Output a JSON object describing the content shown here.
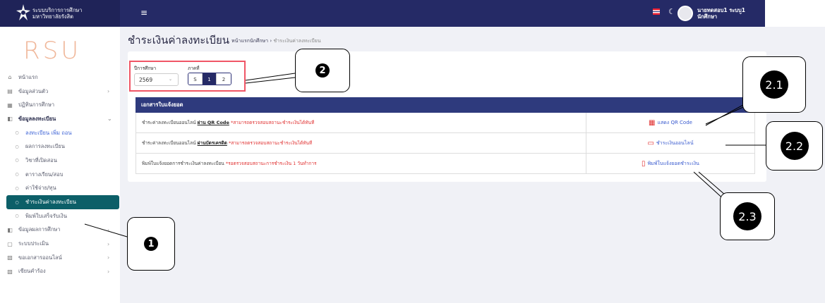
{
  "brand": {
    "line1": "ระบบบริการการศึกษา",
    "line2": "มหาวิทยาลัยรังสิต"
  },
  "topbar": {
    "menu_icon": "≡",
    "user_name": "นายทดสอบ1 ระบบ1",
    "user_role": "นักศึกษา"
  },
  "logo_text": "RSU",
  "sidebar": {
    "items": [
      {
        "label": "หน้าแรก",
        "icon": "home-icon",
        "glyph": "⌂"
      },
      {
        "label": "ข้อมูลส่วนตัว",
        "icon": "id-card-icon",
        "glyph": "▤",
        "chevron": "›"
      },
      {
        "label": "ปฏิทินการศึกษา",
        "icon": "calendar-icon",
        "glyph": "▦"
      },
      {
        "label": "ข้อมูลลงทะเบียน",
        "icon": "register-icon",
        "glyph": "◧",
        "chevron": "⌄"
      },
      {
        "label": "ลงทะเบียน เพิ่ม ถอน",
        "icon": "circle-icon",
        "glyph": "○"
      },
      {
        "label": "ผลการลงทะเบียน",
        "icon": "circle-icon",
        "glyph": "○"
      },
      {
        "label": "วิชาที่เปิดสอน",
        "icon": "circle-icon",
        "glyph": "○"
      },
      {
        "label": "ตารางเรียน/สอบ",
        "icon": "circle-icon",
        "glyph": "○"
      },
      {
        "label": "ค่าใช้จ่าย/ทุน",
        "icon": "circle-icon",
        "glyph": "○"
      },
      {
        "label": "ชำระเงินค่าลงทะเบียน",
        "icon": "circle-icon",
        "glyph": "○"
      },
      {
        "label": "พิมพ์ใบเสร็จรับเงิน",
        "icon": "circle-icon",
        "glyph": "○"
      },
      {
        "label": "ข้อมูลผลการศึกษา",
        "icon": "results-icon",
        "glyph": "◧",
        "chevron": "›"
      },
      {
        "label": "ระบบประเมิน",
        "icon": "evaluation-icon",
        "glyph": "▢",
        "chevron": "›"
      },
      {
        "label": "ขอเอกสารออนไลน์",
        "icon": "document-icon",
        "glyph": "▧",
        "chevron": "›"
      },
      {
        "label": "เขียนคำร้อง",
        "icon": "petition-icon",
        "glyph": "▧",
        "chevron": "›"
      }
    ]
  },
  "header": {
    "title": "ชำระเงินค่าลงทะเบียน",
    "breadcrumb_home": "หน้าแรกนักศึกษา",
    "breadcrumb_sep": "›",
    "breadcrumb_current": "ชำระเงินค่าลงทะเบียน"
  },
  "filters": {
    "year_label": "ปีการศึกษา",
    "year_value": "2569",
    "term_label": "ภาคที่",
    "terms": [
      "S",
      "1",
      "2"
    ],
    "selected_term": "1"
  },
  "table": {
    "header": "เอกสารใบแจ้งยอด",
    "rows": [
      {
        "text": "ชำระค่าลงทะเบียนออนไลน์",
        "method": "ผ่าน QR Code",
        "note": "*สามารถตรวจสอบสถานะชำระเงินได้ทันที",
        "action": "แสดง QR Code",
        "action_icon": "qr-code-icon"
      },
      {
        "text": "ชำระค่าลงทะเบียนออนไลน์",
        "method": "ผ่านบัตรเครดิต",
        "note": "*สามารถตรวจสอบสถานะชำระเงินได้ทันที",
        "action": "ชำระเงินออนไลน์",
        "action_icon": "credit-card-icon"
      },
      {
        "text": "พิมพ์ใบแจ้งยอดการชำระเงินค่าลงทะเบียน",
        "method": "",
        "note": "*รอตรวจสอบสถานะการชำระเงิน 1 วันทำการ",
        "action": "พิมพ์ใบแจ้งยอดชำระเงิน",
        "action_icon": "pdf-icon"
      }
    ]
  },
  "callouts": {
    "c1": "1",
    "c2": "2",
    "c21": "2.1",
    "c22": "2.2",
    "c23": "2.3"
  }
}
